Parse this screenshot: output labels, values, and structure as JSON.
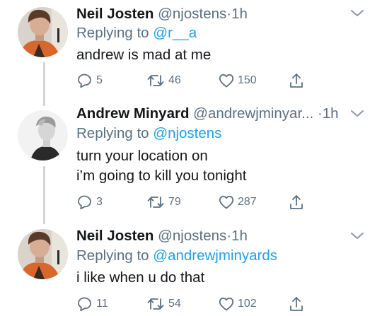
{
  "tweets": [
    {
      "name": "Neil Josten",
      "handle": "@njostens",
      "separator": "·",
      "time": "1h",
      "replying_label": "Replying to",
      "replying_to": "@r__a",
      "lines": [
        "andrew is mad at me"
      ],
      "replies": "5",
      "retweets": "46",
      "likes": "150"
    },
    {
      "name": "Andrew Minyard",
      "handle": "@andrewjminyar...",
      "separator": "·",
      "time": "1h",
      "replying_label": "Replying to",
      "replying_to": "@njostens",
      "lines": [
        "turn your location on",
        "i’m going to kill you tonight"
      ],
      "replies": "3",
      "retweets": "79",
      "likes": "287"
    },
    {
      "name": "Neil Josten",
      "handle": "@njostens",
      "separator": "·",
      "time": "1h",
      "replying_label": "Replying to",
      "replying_to": "@andrewjminyards",
      "lines": [
        "i like when u do that"
      ],
      "replies": "11",
      "retweets": "54",
      "likes": "102"
    }
  ],
  "icons": {
    "reply": "reply-icon",
    "retweet": "retweet-icon",
    "like": "heart-icon",
    "share": "share-icon",
    "more": "chevron-down-icon"
  },
  "colors": {
    "link": "#1da1f2",
    "muted": "#5b7083",
    "text": "#14171a",
    "thread_line": "#cdd6dd"
  }
}
